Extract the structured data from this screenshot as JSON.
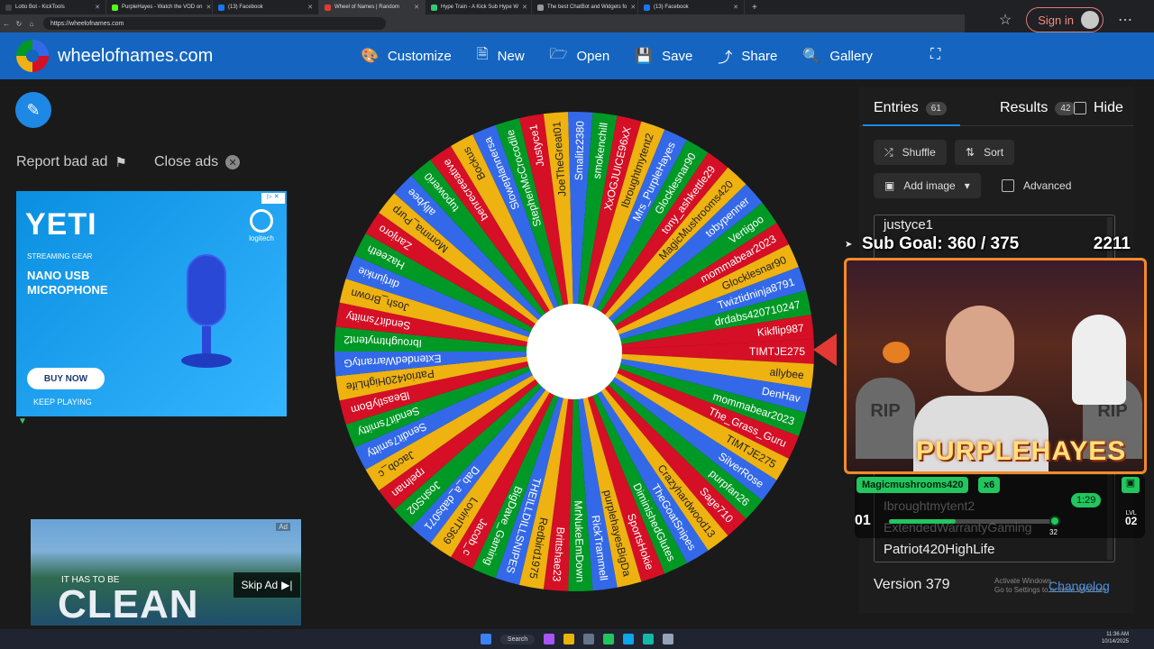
{
  "browser": {
    "tabs": [
      {
        "title": "Lotto Bot - KickTools",
        "color": "#444"
      },
      {
        "title": "PurpleHayes - Watch the VOD on",
        "color": "#53fc18"
      },
      {
        "title": "(13) Facebook",
        "color": "#1877f2"
      },
      {
        "title": "Wheel of Names | Random",
        "color": "#e53935",
        "active": true
      },
      {
        "title": "Hype Train - A Kick Sub Hype W",
        "color": "#2ecc71"
      },
      {
        "title": "The best ChatBot and Widgets fo",
        "color": "#999"
      },
      {
        "title": "(13) Facebook",
        "color": "#1877f2"
      }
    ],
    "url": "https://wheelofnames.com",
    "sign_in": "Sign in"
  },
  "site": {
    "name": "wheelofnames.com",
    "nav": [
      {
        "label": "Customize",
        "icon": "palette-icon"
      },
      {
        "label": "New",
        "icon": "file-icon"
      },
      {
        "label": "Open",
        "icon": "folder-icon"
      },
      {
        "label": "Save",
        "icon": "floppy-icon"
      },
      {
        "label": "Share",
        "icon": "share-icon"
      },
      {
        "label": "Gallery",
        "icon": "search-icon"
      }
    ]
  },
  "ads": {
    "report": "Report bad ad",
    "close": "Close ads",
    "yeti": {
      "title": "YETI",
      "sub": "STREAMING GEAR",
      "headline": "NANO USB MICROPHONE",
      "buy": "BUY NOW",
      "keep": "KEEP PLAYING",
      "brand": "logitech"
    },
    "video": {
      "label": "Ad",
      "small": "IT HAS TO BE",
      "big": "CLEAN",
      "skip": "Skip Ad"
    }
  },
  "wheel": {
    "colors": [
      "#d50f25",
      "#eeb211",
      "#3369e8",
      "#009925"
    ],
    "names": [
      "TIMTJE275",
      "allybee",
      "DenHav",
      "mommabear2023",
      "The_Grass_Guru",
      "TIMTJE275",
      "SilverRose",
      "purpfan26",
      "Sage710",
      "Crazyhardwood13",
      "TheGoatSnipes",
      "DiminishedGlutes",
      "SportsHokie",
      "purplehayesBigDa",
      "RickTrammell",
      "MrNukeEmDown",
      "Brittshae23",
      "Redbird1975",
      "THEILLDILLSNIPES",
      "BigDave_Gaming",
      "Jacob_c",
      "LovinIT369",
      "Dab_a_dabs071",
      "JoshS02",
      "rpelman",
      "Jacob_c",
      "Sendit7smitty",
      "Sendit7smitty",
      "lBeastlyBom",
      "Patriot420HighLife",
      "ExtendedWarrantyG",
      "Ibroughtmytent2",
      "Sendit7smitty",
      "Josh_Brown",
      "dirtjunkie",
      "Hazeeth",
      "Zanjoro",
      "Momma_Purp",
      "allybee",
      "tupoweri0",
      "benrecreeative",
      "Bockus",
      "Sloweplannersa",
      "StephenMcCrocodile",
      "Justyce1",
      "JoeTheGreat01",
      "Smalitz2380",
      "smokenchill",
      "XxOGJUICE96xX",
      "Ibroughtmytent2",
      "Mrs_PurpleHayes",
      "Glocklesnar90",
      "tony_ashkettle29",
      "MagicMushrooms420",
      "tobypenner",
      "Vertigoo",
      "mommabear2023",
      "Glocklesnar90",
      "Twiztidninja8791",
      "drdabs420710247",
      "Kikflip987"
    ]
  },
  "panel": {
    "tabs": [
      {
        "label": "Entries",
        "count": "61"
      },
      {
        "label": "Results",
        "count": "42"
      }
    ],
    "hide": "Hide",
    "shuffle": "Shuffle",
    "sort": "Sort",
    "add_image": "Add image",
    "advanced": "Advanced",
    "entries_visible": [
      "justyce1",
      "Patriot420HighLife"
    ],
    "version": "Version 379",
    "changelog": "Changelog",
    "activate_windows": [
      "Activate Windows",
      "Go to Settings to activate Windows."
    ]
  },
  "overlay": {
    "sub_goal": "Sub Goal: 360 / 375",
    "counter": "2211",
    "channel": "PURPLEHAYES",
    "rip": "RIP",
    "chat_user": "Magicmushrooms420",
    "chat_mult": "x6",
    "timer": "1:29",
    "level_left": "01",
    "level_right_label": "LVL",
    "level_right": "02",
    "hype_count": "32",
    "hype_progress": 0.4,
    "ghost_entries": [
      "Ibroughtmytent2",
      "ExtendedWarrantyGaming"
    ]
  },
  "taskbar": {
    "search": "Search",
    "time": "11:36 AM",
    "date": "10/14/2025"
  }
}
